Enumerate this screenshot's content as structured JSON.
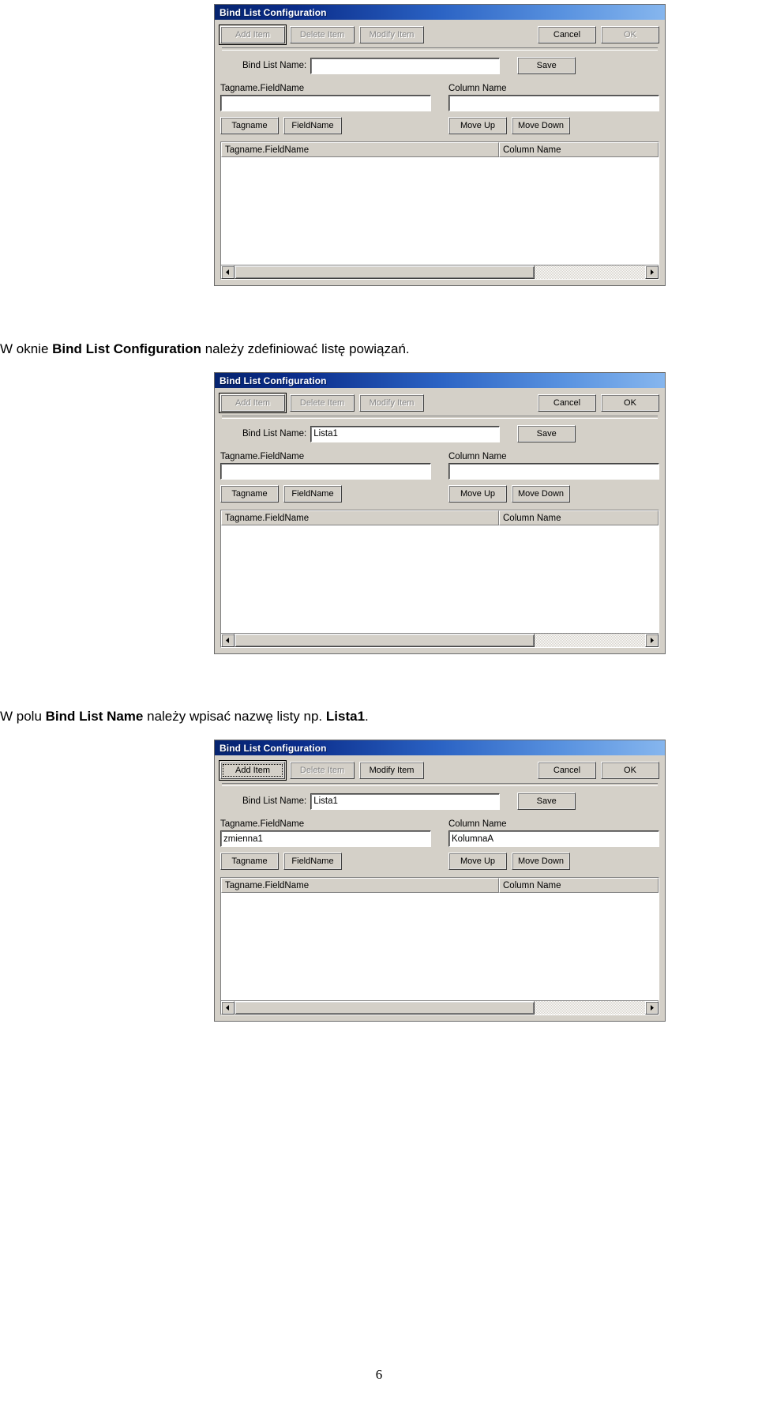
{
  "document": {
    "page_number": "6",
    "captions": [
      {
        "prefix": "W oknie ",
        "bold": "Bind List Configuration",
        "suffix": " należy zdefiniować listę powiązań."
      },
      {
        "prefix": "W polu ",
        "bold": "Bind List Name",
        "middle": " należy wpisać nazwę listy np. ",
        "bold2": "Lista1",
        "suffix": "."
      }
    ]
  },
  "colors": {
    "title_gradient_start": "#06246f",
    "title_gradient_end": "#86b6ee",
    "dialog_face": "#d4d0c8",
    "text": "#000000",
    "disabled_text": "#868686",
    "field_background": "#ffffff"
  },
  "dialog_common": {
    "title": "Bind List Configuration",
    "toolbar": {
      "add_item": "Add Item",
      "delete_item": "Delete Item",
      "modify_item": "Modify Item",
      "cancel": "Cancel",
      "ok": "OK"
    },
    "bind_list_name_label": "Bind List Name:",
    "save_label": "Save",
    "tagname_fieldname_label": "Tagname.FieldName",
    "column_name_label": "Column Name",
    "tagname_button": "Tagname",
    "fieldname_button": "FieldName",
    "move_up_button": "Move Up",
    "move_down_button": "Move Down",
    "list_header_col1": "Tagname.FieldName",
    "list_header_col2": "Column Name"
  },
  "dialog1": {
    "title": "Bind List Configuration",
    "toolbar": {
      "add_item": "Add Item",
      "delete_item": "Delete Item",
      "modify_item": "Modify Item",
      "cancel": "Cancel",
      "ok": "OK"
    },
    "bind_list_name_label": "Bind List Name:",
    "bind_list_name_value": "",
    "save_label": "Save",
    "tagname_fieldname_label": "Tagname.FieldName",
    "tagname_fieldname_value": "",
    "column_name_label": "Column Name",
    "column_name_value": "",
    "tagname_button": "Tagname",
    "fieldname_button": "FieldName",
    "move_up_button": "Move Up",
    "move_down_button": "Move Down",
    "list_header_col1": "Tagname.FieldName",
    "list_header_col2": "Column Name",
    "list_rows": []
  },
  "dialog2": {
    "title": "Bind List Configuration",
    "toolbar": {
      "add_item": "Add Item",
      "delete_item": "Delete Item",
      "modify_item": "Modify Item",
      "cancel": "Cancel",
      "ok": "OK"
    },
    "bind_list_name_label": "Bind List Name:",
    "bind_list_name_value": "Lista1",
    "save_label": "Save",
    "tagname_fieldname_label": "Tagname.FieldName",
    "tagname_fieldname_value": "",
    "column_name_label": "Column Name",
    "column_name_value": "",
    "tagname_button": "Tagname",
    "fieldname_button": "FieldName",
    "move_up_button": "Move Up",
    "move_down_button": "Move Down",
    "list_header_col1": "Tagname.FieldName",
    "list_header_col2": "Column Name",
    "list_rows": []
  },
  "dialog3": {
    "title": "Bind List Configuration",
    "toolbar": {
      "add_item": "Add Item",
      "delete_item": "Delete Item",
      "modify_item": "Modify Item",
      "cancel": "Cancel",
      "ok": "OK"
    },
    "bind_list_name_label": "Bind List Name:",
    "bind_list_name_value": "Lista1",
    "save_label": "Save",
    "tagname_fieldname_label": "Tagname.FieldName",
    "tagname_fieldname_value": "zmienna1",
    "column_name_label": "Column Name",
    "column_name_value": "KolumnaA",
    "tagname_button": "Tagname",
    "fieldname_button": "FieldName",
    "move_up_button": "Move Up",
    "move_down_button": "Move Down",
    "list_header_col1": "Tagname.FieldName",
    "list_header_col2": "Column Name",
    "list_rows": []
  }
}
